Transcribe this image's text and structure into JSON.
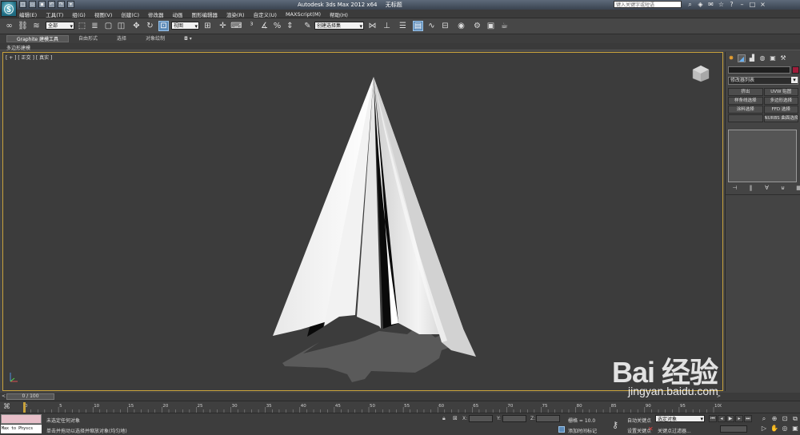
{
  "window": {
    "app_title": "Autodesk 3ds Max  2012 x64",
    "doc_title": "无标题",
    "search_placeholder": "键入关键字或短语"
  },
  "menu": [
    "编辑(E)",
    "工具(T)",
    "组(G)",
    "视图(V)",
    "创建(C)",
    "修改器",
    "动画",
    "图形编辑器",
    "渲染(R)",
    "自定义(U)",
    "MAXScript(M)",
    "帮助(H)"
  ],
  "toolbar": {
    "selection_filter": "全部",
    "ref_coord": "视图",
    "named_selection": "创建选择集"
  },
  "ribbon": {
    "tabs": [
      "Graphite 建模工具",
      "自由形式",
      "选择",
      "对象绘制"
    ],
    "sub_label": "多边形建模"
  },
  "viewport": {
    "label": "[ + ] [ 正交 ] [ 真实 ]"
  },
  "command_panel": {
    "modifier_list": "修改器列表",
    "modifier_buttons": [
      "挤出",
      "UVW 贴图",
      "样条线选择",
      "多边形选择",
      "涂料选择",
      "FFD 选择",
      "",
      "NURBS 曲面选择"
    ]
  },
  "timeline": {
    "frame_display": "0 / 100",
    "prev": "<",
    "next": ">",
    "ticks": [
      "0",
      "5",
      "10",
      "15",
      "20",
      "25",
      "30",
      "35",
      "40",
      "45",
      "50",
      "55",
      "60",
      "65",
      "70",
      "75",
      "80",
      "85",
      "90",
      "95",
      "100"
    ]
  },
  "status": {
    "maxscript_text": "Max to Physcs",
    "line1": "未选定任何对象",
    "line2": "单击并拖动以选择并缩放对象(均匀地)",
    "x_label": "X:",
    "y_label": "Y:",
    "z_label": "Z:",
    "grid": "栅格 = 10.0",
    "add_time_tag": "添加时间标记",
    "auto_key": "自动关键点",
    "set_key": "设置关键点",
    "selection_set": "选定对象",
    "key_filters": "关键点过滤器..."
  },
  "watermark": {
    "logo": "Bai 经验",
    "url": "jingyan.baidu.com"
  },
  "colors": {
    "viewport_border": "#c8a23c",
    "model_face": "#f0f0f0",
    "object_color": "#a01c3a"
  }
}
